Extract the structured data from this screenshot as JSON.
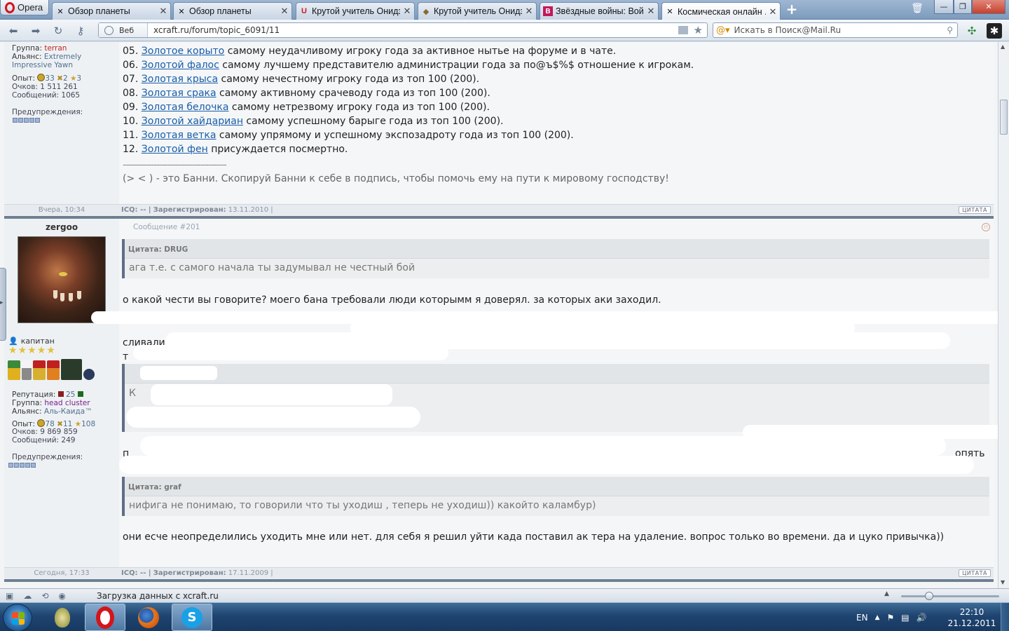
{
  "browser": {
    "menu_label": "Opera",
    "tabs": [
      {
        "label": "Обзор планеты",
        "icon": "swords-icon"
      },
      {
        "label": "Обзор планеты",
        "icon": "swords-icon"
      },
      {
        "label": "Крутой учитель Онидз...",
        "icon": "opera-page-icon"
      },
      {
        "label": "Крутой учитель Онидз...",
        "icon": "image-icon"
      },
      {
        "label": "Звёздные войны: Вой...",
        "icon": "b-icon"
      },
      {
        "label": "Космическая онлайн ...",
        "icon": "swords-icon"
      }
    ],
    "web_label": "Веб",
    "url": "xcraft.ru/forum/topic_6091/11",
    "search_placeholder": "Искать в Поиск@Mail.Ru",
    "status_text": "Загрузка данных с xcraft.ru"
  },
  "post1": {
    "sidebar": {
      "group_key": "Группа:",
      "group_value": "terran",
      "alliance_key": "Альянс:",
      "alliance_value": "Extremely Impressive Yawn",
      "exp_key": "Опыт:",
      "exp_values": [
        "33",
        "2",
        "3"
      ],
      "points": "Очков: 1 511 261",
      "messages": "Сообщений: 1065",
      "warnings": "Предупреждения:"
    },
    "lines": [
      {
        "num": "05.",
        "link": "Золотое корыто",
        "rest": " самому неудачливому игроку года за активное нытье на форуме и в чате."
      },
      {
        "num": "06.",
        "link": "Золотой фалос",
        "rest": " самому лучшему представителю администрации года за по@ъ$%$ отношение к игрокам."
      },
      {
        "num": "07.",
        "link": "Золотая крыса",
        "rest": " самому нечестному игроку года из топ 100 (200)."
      },
      {
        "num": "08.",
        "link": "Золотая срака",
        "rest": " самому активному срачеводу года из топ 100 (200)."
      },
      {
        "num": "09.",
        "link": "Золотая белочка",
        "rest": " самому нетрезвому игроку года из топ 100 (200)."
      },
      {
        "num": "10.",
        "link": "Золотой хайдариан",
        "rest": " самому успешному барыге года из топ 100 (200)."
      },
      {
        "num": "11.",
        "link": "Золотая ветка",
        "rest": " самому упрямому и успешному экспозадроту года из топ 100 (200)."
      },
      {
        "num": "12.",
        "link": "Золотой фен",
        "rest": " присуждается посмертно."
      }
    ],
    "sig_sep": "----------------------------------------",
    "signature": "(> < ) - это Банни. Скопируй Банни к себе в подпись, чтобы помочь ему на пути к мировому господству!",
    "date": "Вчера, 10:34",
    "meta_icq": "ICQ: -- |",
    "meta_reg_key": "Зарегистрирован:",
    "meta_reg_val": "13.11.2010 |",
    "quote_btn": "ЦИТАТА"
  },
  "post2": {
    "author": "zergoo",
    "post_num": "Сообщение #201",
    "rank": "капитан",
    "sidebar": {
      "rep_key": "Репутация:",
      "rep_value": "25",
      "group_key": "Группа:",
      "group_value": "head cluster",
      "alliance_key": "Альянс:",
      "alliance_value": "Аль-Каида™",
      "exp_key": "Опыт:",
      "exp_values": [
        "78",
        "11",
        "108"
      ],
      "points": "Очков: 9 869 859",
      "messages": "Сообщений: 249",
      "warnings": "Предупреждения:"
    },
    "quote1_head": "Цитата: DRUG",
    "quote1_body": "ага т.е. с самого начала ты задумывал не честный бой",
    "text1": "о какой чести вы говорите? моего бана требовали люди которымм я доверял. за которых аки заходил.",
    "frag_sliv": "сливали",
    "frag_t": "т",
    "frag_k": "К",
    "frag_p": "п",
    "frag_opyat": "опять",
    "quote2_head": "Цитата: graf",
    "quote2_body": "нифига не понимаю, то говорили что ты уходиш , теперь не уходиш)) какойто каламбур)",
    "text2": "они есче неопределились уходить мне или нет. для себя я решил уйти када поставил ак тера на удаление. вопрос только во времени. да и цуко привычка))",
    "date": "Сегодня, 17:33",
    "meta_icq": "ICQ: -- |",
    "meta_reg_key": "Зарегистрирован:",
    "meta_reg_val": "17.11.2009 |",
    "quote_btn": "ЦИТАТА"
  },
  "taskbar": {
    "lang": "EN",
    "time": "22:10",
    "date": "21.12.2011"
  }
}
